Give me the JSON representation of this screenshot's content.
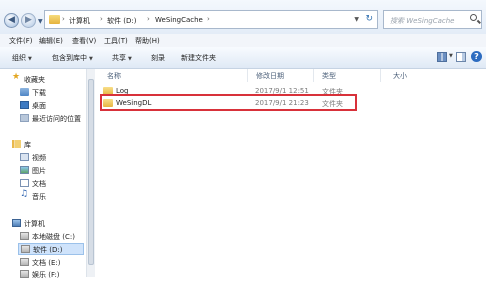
{
  "address": {
    "path": [
      "计算机",
      "软件 (D:)",
      "WeSingCache"
    ],
    "search_placeholder": "搜索 WeSingCache"
  },
  "menu": [
    "文件(F)",
    "编辑(E)",
    "查看(V)",
    "工具(T)",
    "帮助(H)"
  ],
  "toolbar": {
    "organize": "组织",
    "include_in_library": "包含到库中",
    "share": "共享",
    "burn": "刻录",
    "new_folder": "新建文件夹"
  },
  "nav": {
    "favorites": "收藏夹",
    "downloads": "下载",
    "desktop": "桌面",
    "recent": "最近访问的位置",
    "libraries": "库",
    "videos": "视频",
    "pictures": "图片",
    "documents": "文档",
    "music": "音乐",
    "computer": "计算机",
    "local_disk": "本地磁盘 (C:)",
    "software": "软件 (D:)",
    "docs_drive": "文档 (E:)",
    "entertainment": "娱乐 (F:)"
  },
  "columns": {
    "name": "名称",
    "modified": "修改日期",
    "type": "类型",
    "size": "大小"
  },
  "files": [
    {
      "name": "Log",
      "modified": "2017/9/1 12:51",
      "type": "文件夹"
    },
    {
      "name": "WeSingDL",
      "modified": "2017/9/1 21:23",
      "type": "文件夹"
    }
  ]
}
